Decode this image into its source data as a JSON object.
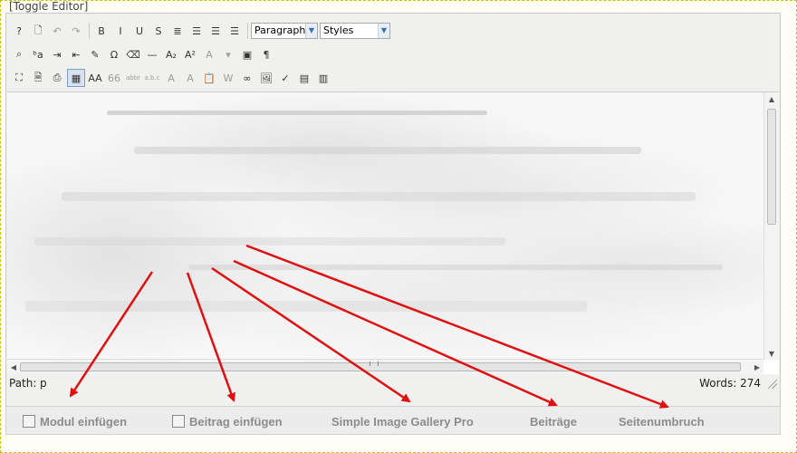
{
  "toggle_editor": "[Toggle Editor]",
  "toolbar": {
    "row1": [
      {
        "name": "help-icon",
        "glyph": "?"
      },
      {
        "name": "new-document-icon",
        "glyph": "🗋"
      },
      {
        "name": "undo-icon",
        "glyph": "↶",
        "disabled": true
      },
      {
        "name": "redo-icon",
        "glyph": "↷",
        "disabled": true
      },
      {
        "sep": true
      },
      {
        "name": "bold-icon",
        "glyph": "B"
      },
      {
        "name": "italic-icon",
        "glyph": "I"
      },
      {
        "name": "underline-icon",
        "glyph": "U"
      },
      {
        "name": "strikethrough-icon",
        "glyph": "S"
      },
      {
        "name": "align-justify-icon",
        "glyph": "≣"
      },
      {
        "name": "align-center-icon",
        "glyph": "☰"
      },
      {
        "name": "align-left-icon",
        "glyph": "☰"
      },
      {
        "name": "align-right-icon",
        "glyph": "☰"
      }
    ],
    "format_select": "Paragraph",
    "styles_select": "Styles",
    "row2": [
      {
        "name": "find-icon",
        "glyph": "⌕"
      },
      {
        "name": "replace-icon",
        "glyph": "ᵇa"
      },
      {
        "name": "indent-icon",
        "glyph": "⇥"
      },
      {
        "name": "outdent-icon",
        "glyph": "⇤"
      },
      {
        "name": "cleanup-icon",
        "glyph": "✎"
      },
      {
        "name": "special-char-icon",
        "glyph": "Ω"
      },
      {
        "name": "eraser-icon",
        "glyph": "⌫"
      },
      {
        "name": "horizontal-rule-icon",
        "glyph": "—"
      },
      {
        "name": "subscript-icon",
        "glyph": "A₂"
      },
      {
        "name": "superscript-icon",
        "glyph": "A²"
      },
      {
        "name": "text-color-icon",
        "glyph": "A",
        "disabled": true
      },
      {
        "name": "text-color-dropdown-icon",
        "glyph": "▾",
        "disabled": true
      },
      {
        "name": "template-icon",
        "glyph": "▣"
      },
      {
        "name": "pilcrow-icon",
        "glyph": "¶"
      }
    ],
    "row3": [
      {
        "name": "fullscreen-icon",
        "glyph": "⛶"
      },
      {
        "name": "preview-icon",
        "glyph": "🗎"
      },
      {
        "name": "print-icon",
        "glyph": "⎙"
      },
      {
        "name": "visual-aid-icon",
        "glyph": "▦",
        "selected": true
      },
      {
        "name": "style-props-icon",
        "glyph": "AA"
      },
      {
        "name": "quote-icon",
        "glyph": "66",
        "disabled": true
      },
      {
        "name": "abbr-icon",
        "glyph": "abbr",
        "disabled": true
      },
      {
        "name": "acronym-icon",
        "glyph": "a.b.c",
        "disabled": true
      },
      {
        "name": "delete-text-icon",
        "glyph": "A",
        "disabled": true
      },
      {
        "name": "insert-text-icon",
        "glyph": "A",
        "disabled": true
      },
      {
        "name": "paste-text-icon",
        "glyph": "📋"
      },
      {
        "name": "paste-word-icon",
        "glyph": "W",
        "disabled": true
      },
      {
        "name": "link-icon",
        "glyph": "∞"
      },
      {
        "name": "image-icon",
        "glyph": "🖼"
      },
      {
        "name": "spellcheck-icon",
        "glyph": "✓"
      },
      {
        "name": "table-icon",
        "glyph": "▤"
      },
      {
        "name": "layer-icon",
        "glyph": "▥"
      }
    ]
  },
  "status": {
    "path_label": "Path:",
    "path_value": "p",
    "words": "Words: 274"
  },
  "buttons": [
    {
      "name": "module-insert-button",
      "label": "Modul einfügen"
    },
    {
      "name": "article-insert-button",
      "label": "Beitrag einfügen"
    },
    {
      "name": "image-gallery-button",
      "label": "Simple Image Gallery Pro"
    },
    {
      "name": "articles-button",
      "label": "Beiträge"
    },
    {
      "name": "page-break-button",
      "label": "Seitenumbruch"
    }
  ],
  "colors": {
    "arrow": "#e01010",
    "frame": "#c8c400",
    "button_text": "#8c8c8c"
  }
}
